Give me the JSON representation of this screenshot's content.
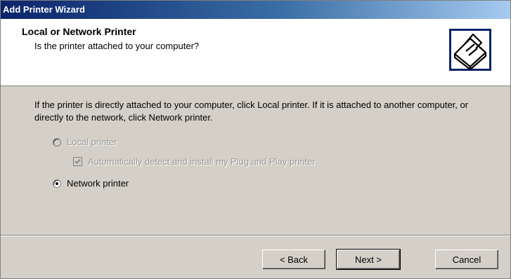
{
  "window": {
    "title": "Add Printer Wizard"
  },
  "header": {
    "title": "Local or Network Printer",
    "subtitle": "Is the printer attached to your computer?",
    "icon": "printer-icon"
  },
  "content": {
    "description": "If the printer is directly attached to your computer, click Local printer.  If it is attached to another computer, or directly to the network, click Network printer.",
    "options": {
      "local_printer": {
        "label": "Local printer",
        "selected": false,
        "enabled": false
      },
      "auto_detect": {
        "label": "Automatically detect and install my Plug and Play printer",
        "checked": true,
        "enabled": false
      },
      "network_printer": {
        "label": "Network printer",
        "selected": true,
        "enabled": true
      }
    }
  },
  "buttons": {
    "back": "< Back",
    "next": "Next >",
    "cancel": "Cancel"
  },
  "colors": {
    "titlebar_start": "#0a246a",
    "titlebar_end": "#a6caf0",
    "dialog_bg": "#d4d0c8"
  }
}
